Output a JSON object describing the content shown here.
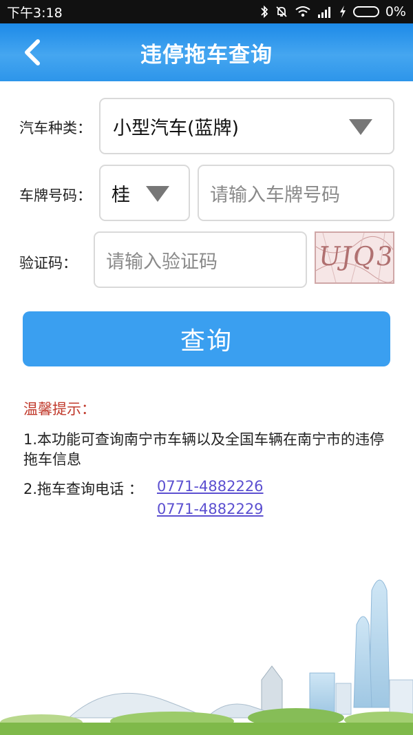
{
  "status_bar": {
    "time": "下午3:18",
    "battery_percent": "0%"
  },
  "header": {
    "title": "违停拖车查询"
  },
  "form": {
    "car_type_label": "汽车种类：",
    "car_type_value": "小型汽车(蓝牌)",
    "plate_label": "车牌号码：",
    "plate_prefix": "桂",
    "plate_placeholder": "请输入车牌号码",
    "captcha_label": "验证码：",
    "captcha_placeholder": "请输入验证码",
    "captcha_text": "UJQ3"
  },
  "query_button": "查询",
  "tips": {
    "title": "温馨提示：",
    "item1": "1.本功能可查询南宁市车辆以及全国车辆在南宁市的违停拖车信息",
    "item2_label": "2.拖车查询电话 ：",
    "phone1": "0771-4882226",
    "phone2": "0771-4882229"
  },
  "colors": {
    "header": "#2d95ea",
    "button": "#3a9ff0",
    "tip_title": "#c0392b",
    "link": "#5b4fd0"
  }
}
